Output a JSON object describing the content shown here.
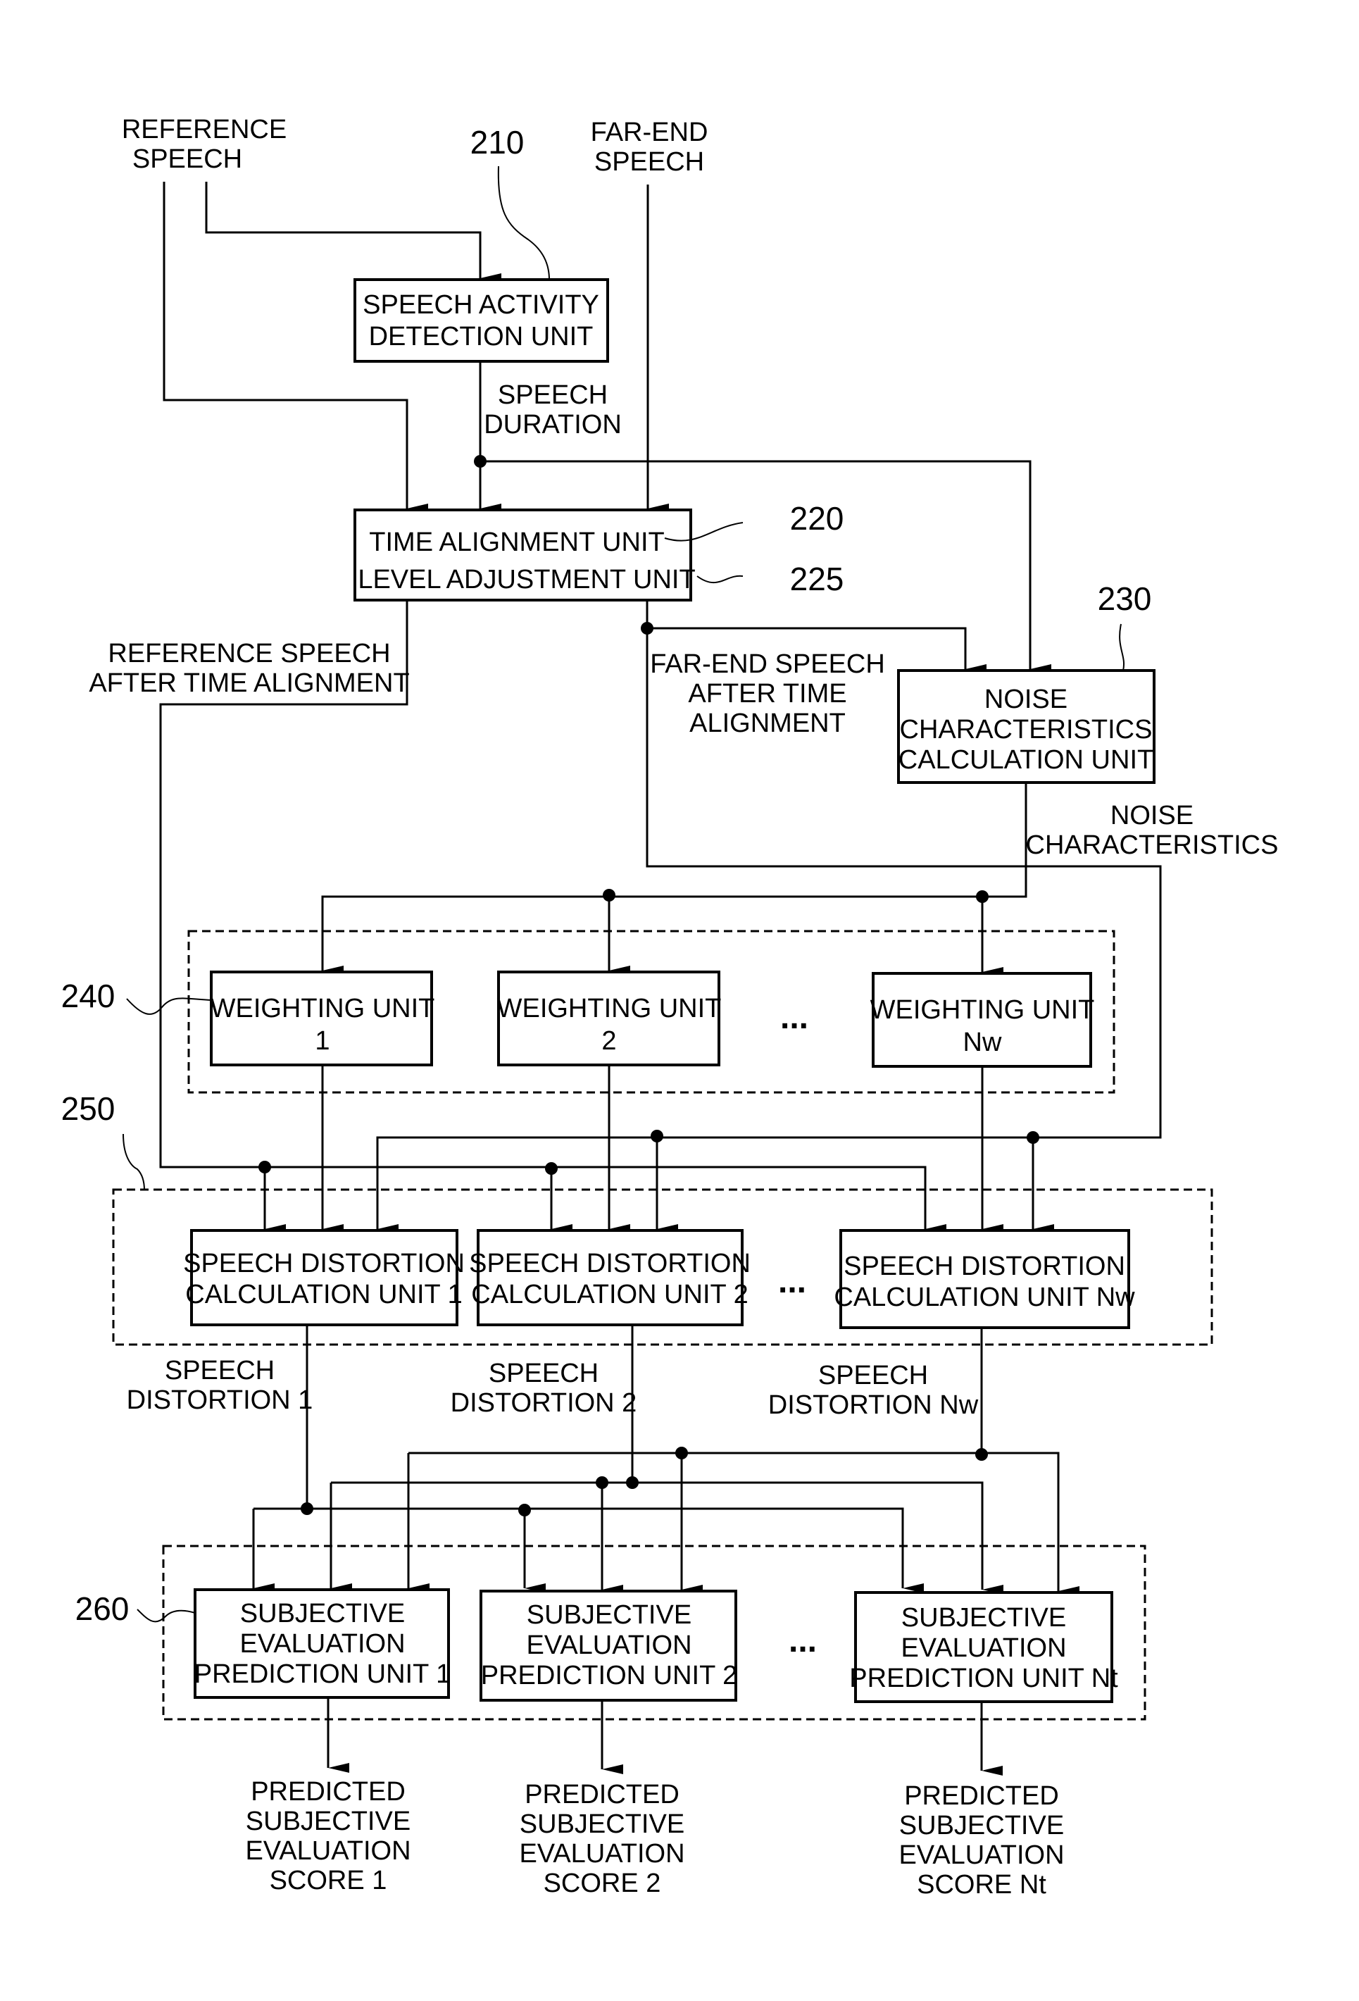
{
  "inputs": {
    "reference_speech": [
      "REFERENCE",
      "SPEECH"
    ],
    "far_end_speech": [
      "FAR-END",
      "SPEECH"
    ]
  },
  "ref_numbers": {
    "speech_activity": "210",
    "time_alignment": "220",
    "level_adjustment": "225",
    "noise_characteristics": "230",
    "weighting": "240",
    "speech_distortion": "250",
    "subjective_evaluation": "260"
  },
  "blocks": {
    "speech_activity": [
      "SPEECH ACTIVITY",
      "DETECTION UNIT"
    ],
    "time_alignment": "TIME ALIGNMENT UNIT",
    "level_adjustment": "LEVEL ADJUSTMENT UNIT",
    "noise_characteristics": [
      "NOISE",
      "CHARACTERISTICS",
      "CALCULATION UNIT"
    ],
    "weighting_units": [
      [
        "WEIGHTING UNIT",
        "1"
      ],
      [
        "WEIGHTING UNIT",
        "2"
      ],
      [
        "WEIGHTING UNIT",
        "Nw"
      ]
    ],
    "speech_distortion_units": [
      [
        "SPEECH DISTORTION",
        "CALCULATION UNIT 1"
      ],
      [
        "SPEECH DISTORTION",
        "CALCULATION UNIT 2"
      ],
      [
        "SPEECH DISTORTION",
        "CALCULATION UNIT Nw"
      ]
    ],
    "subjective_units": [
      [
        "SUBJECTIVE",
        "EVALUATION",
        "PREDICTION UNIT 1"
      ],
      [
        "SUBJECTIVE",
        "EVALUATION",
        "PREDICTION UNIT 2"
      ],
      [
        "SUBJECTIVE",
        "EVALUATION",
        "PREDICTION UNIT Nt"
      ]
    ],
    "ellipsis": "..."
  },
  "signals": {
    "speech_duration": [
      "SPEECH",
      "DURATION"
    ],
    "reference_after_alignment": [
      "REFERENCE SPEECH",
      "AFTER TIME ALIGNMENT"
    ],
    "far_end_after_alignment": [
      "FAR-END SPEECH",
      "AFTER TIME",
      "ALIGNMENT"
    ],
    "noise_characteristics": [
      "NOISE",
      "CHARACTERISTICS"
    ],
    "speech_distortions": [
      [
        "SPEECH",
        "DISTORTION 1"
      ],
      [
        "SPEECH",
        "DISTORTION 2"
      ],
      [
        "SPEECH",
        "DISTORTION Nw"
      ]
    ]
  },
  "outputs": [
    [
      "PREDICTED",
      "SUBJECTIVE",
      "EVALUATION",
      "SCORE 1"
    ],
    [
      "PREDICTED",
      "SUBJECTIVE",
      "EVALUATION",
      "SCORE 2"
    ],
    [
      "PREDICTED",
      "SUBJECTIVE",
      "EVALUATION",
      "SCORE Nt"
    ]
  ]
}
